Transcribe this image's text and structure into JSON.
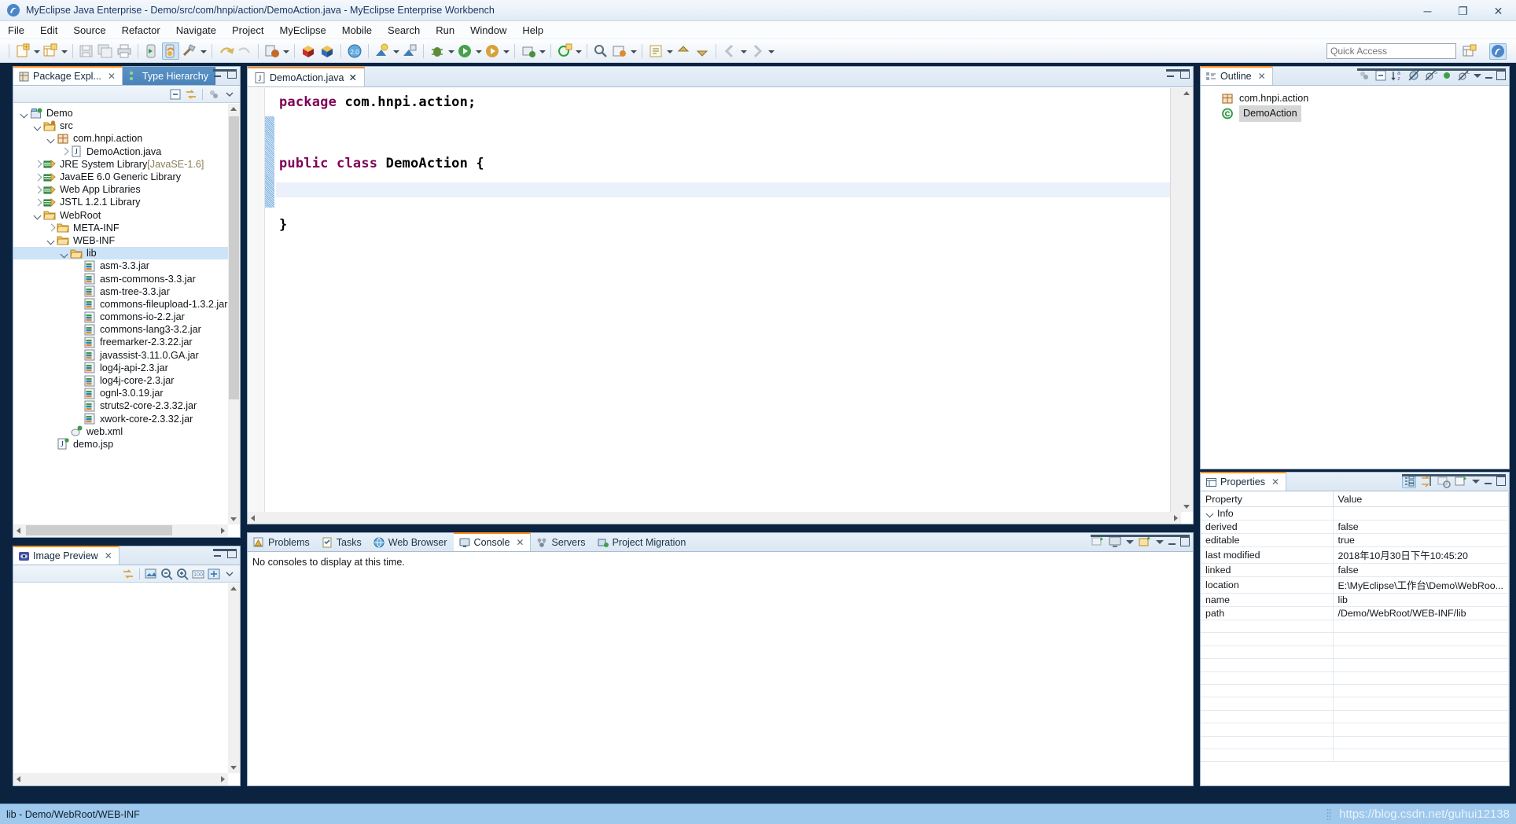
{
  "window": {
    "title": "MyEclipse Java Enterprise - Demo/src/com/hnpi/action/DemoAction.java - MyEclipse Enterprise Workbench",
    "app_icon": "myeclipse-icon",
    "minimize": "─",
    "maximize": "❐",
    "close": "✕"
  },
  "menu": [
    {
      "label": "File"
    },
    {
      "label": "Edit"
    },
    {
      "label": "Source"
    },
    {
      "label": "Refactor"
    },
    {
      "label": "Navigate"
    },
    {
      "label": "Project"
    },
    {
      "label": "MyEclipse"
    },
    {
      "label": "Mobile"
    },
    {
      "label": "Search"
    },
    {
      "label": "Run"
    },
    {
      "label": "Window"
    },
    {
      "label": "Help"
    }
  ],
  "toolbar": {
    "quick_access_placeholder": "Quick Access",
    "quick_access_value": "",
    "buttons": [
      "new-wizard-icon",
      "new-wizard-dropdown",
      "new-jee-icon",
      "new-jee-dropdown",
      "save-icon",
      "save-all-icon",
      "print-icon",
      "run-server-icon",
      "deploy-icon",
      "build-icon",
      "build-dropdown",
      "undo-icon",
      "redo-icon",
      "publish-icon",
      "publish-dropdown",
      "package-icon",
      "package-blue-icon",
      "web20-icon",
      "db-browser-icon",
      "db-browser-dropdown",
      "db-explorer-icon",
      "debug-icon",
      "debug-dropdown",
      "run-icon",
      "run-dropdown",
      "coverage-icon",
      "coverage-dropdown",
      "external-tools-icon",
      "external-tools-dropdown",
      "new-class-icon",
      "new-class-dropdown",
      "search-icon",
      "open-type-icon",
      "open-type-dropdown",
      "annotation-icon",
      "annotation-dropdown",
      "prev-annotation-icon",
      "next-annotation-icon",
      "back-icon",
      "back-dropdown",
      "forward-icon",
      "forward-dropdown"
    ],
    "perspective_buttons": [
      "open-perspective-icon",
      "myeclipse-perspective-icon"
    ]
  },
  "package_explorer": {
    "tabs": [
      {
        "label": "Package Expl...",
        "icon": "package-explorer-icon",
        "active": true,
        "closable": true
      },
      {
        "label": "Type Hierarchy",
        "icon": "type-hierarchy-icon",
        "active": false,
        "closable": false
      }
    ],
    "toolbar_icons": [
      "collapse-all-icon",
      "link-with-editor-icon",
      "view-menu-icon",
      "view-dropdown-icon"
    ],
    "tree": [
      {
        "depth": 0,
        "twisty": "down",
        "icon": "project-icon",
        "label": "Demo",
        "suffix": ""
      },
      {
        "depth": 1,
        "twisty": "down",
        "icon": "source-folder-icon",
        "label": "src",
        "suffix": ""
      },
      {
        "depth": 2,
        "twisty": "down",
        "icon": "package-icon",
        "label": "com.hnpi.action",
        "suffix": ""
      },
      {
        "depth": 3,
        "twisty": "right",
        "icon": "java-file-icon",
        "label": "DemoAction.java",
        "suffix": ""
      },
      {
        "depth": 1,
        "twisty": "right",
        "icon": "library-icon",
        "label": "JRE System Library",
        "suffix": "[JavaSE-1.6]"
      },
      {
        "depth": 1,
        "twisty": "right",
        "icon": "library-icon",
        "label": "JavaEE 6.0 Generic Library",
        "suffix": ""
      },
      {
        "depth": 1,
        "twisty": "right",
        "icon": "library-icon",
        "label": "Web App Libraries",
        "suffix": ""
      },
      {
        "depth": 1,
        "twisty": "right",
        "icon": "library-icon",
        "label": "JSTL 1.2.1 Library",
        "suffix": ""
      },
      {
        "depth": 1,
        "twisty": "down",
        "icon": "folder-icon",
        "label": "WebRoot",
        "suffix": ""
      },
      {
        "depth": 2,
        "twisty": "right",
        "icon": "folder-icon",
        "label": "META-INF",
        "suffix": ""
      },
      {
        "depth": 2,
        "twisty": "down",
        "icon": "folder-icon",
        "label": "WEB-INF",
        "suffix": ""
      },
      {
        "depth": 3,
        "twisty": "down",
        "icon": "folder-icon",
        "label": "lib",
        "suffix": "",
        "selected": true
      },
      {
        "depth": 4,
        "twisty": "none",
        "icon": "jar-icon",
        "label": "asm-3.3.jar",
        "suffix": ""
      },
      {
        "depth": 4,
        "twisty": "none",
        "icon": "jar-icon",
        "label": "asm-commons-3.3.jar",
        "suffix": ""
      },
      {
        "depth": 4,
        "twisty": "none",
        "icon": "jar-icon",
        "label": "asm-tree-3.3.jar",
        "suffix": ""
      },
      {
        "depth": 4,
        "twisty": "none",
        "icon": "jar-icon",
        "label": "commons-fileupload-1.3.2.jar",
        "suffix": ""
      },
      {
        "depth": 4,
        "twisty": "none",
        "icon": "jar-icon",
        "label": "commons-io-2.2.jar",
        "suffix": ""
      },
      {
        "depth": 4,
        "twisty": "none",
        "icon": "jar-icon",
        "label": "commons-lang3-3.2.jar",
        "suffix": ""
      },
      {
        "depth": 4,
        "twisty": "none",
        "icon": "jar-icon",
        "label": "freemarker-2.3.22.jar",
        "suffix": ""
      },
      {
        "depth": 4,
        "twisty": "none",
        "icon": "jar-icon",
        "label": "javassist-3.11.0.GA.jar",
        "suffix": ""
      },
      {
        "depth": 4,
        "twisty": "none",
        "icon": "jar-icon",
        "label": "log4j-api-2.3.jar",
        "suffix": ""
      },
      {
        "depth": 4,
        "twisty": "none",
        "icon": "jar-icon",
        "label": "log4j-core-2.3.jar",
        "suffix": ""
      },
      {
        "depth": 4,
        "twisty": "none",
        "icon": "jar-icon",
        "label": "ognl-3.0.19.jar",
        "suffix": ""
      },
      {
        "depth": 4,
        "twisty": "none",
        "icon": "jar-icon",
        "label": "struts2-core-2.3.32.jar",
        "suffix": ""
      },
      {
        "depth": 4,
        "twisty": "none",
        "icon": "jar-icon",
        "label": "xwork-core-2.3.32.jar",
        "suffix": ""
      },
      {
        "depth": 3,
        "twisty": "none",
        "icon": "xml-file-icon",
        "label": "web.xml",
        "suffix": ""
      },
      {
        "depth": 2,
        "twisty": "none",
        "icon": "jsp-file-icon",
        "label": "demo.jsp",
        "suffix": ""
      }
    ]
  },
  "image_preview": {
    "tab_label": "Image Preview",
    "tab_icon": "image-preview-icon",
    "toolbar_icons": [
      "link-icon",
      "fit-image-icon",
      "zoom-out-icon",
      "zoom-in-icon",
      "zoom-100-icon",
      "fit-window-icon",
      "view-menu-icon"
    ],
    "content": ""
  },
  "editor": {
    "tab_label": "DemoAction.java",
    "tab_icon": "java-file-icon",
    "tab_close": "✕",
    "lines": [
      {
        "segments": [
          {
            "text": "package",
            "style": "kw"
          },
          {
            "text": " com.hnpi.action;",
            "style": "plain"
          }
        ]
      },
      {
        "segments": []
      },
      {
        "segments": [
          {
            "text": "public class",
            "style": "kw"
          },
          {
            "text": " DemoAction {",
            "style": "plain"
          }
        ]
      },
      {
        "segments": []
      },
      {
        "segments": [
          {
            "text": "}",
            "style": "plain"
          }
        ]
      }
    ]
  },
  "outline": {
    "tab_label": "Outline",
    "tab_icon": "outline-icon",
    "tab_close": "✕",
    "toolbar_icons": [
      "collapse-all-icon",
      "sort-icon",
      "hide-fields-icon",
      "hide-static-icon",
      "hide-public-icon",
      "hide-local-icon",
      "view-menu-icon"
    ],
    "items": [
      {
        "icon": "package-icon",
        "label": "com.hnpi.action",
        "selected": false
      },
      {
        "icon": "class-icon",
        "label": "DemoAction",
        "selected": true
      }
    ]
  },
  "properties": {
    "tab_label": "Properties",
    "tab_icon": "properties-icon",
    "tab_close": "✕",
    "toolbar_icons": [
      "show-categories-icon",
      "show-advanced-icon",
      "restore-default-icon",
      "pin-icon",
      "view-menu-icon"
    ],
    "columns": [
      "Property",
      "Value"
    ],
    "group": "Info",
    "rows": [
      {
        "property": "derived",
        "value": "false"
      },
      {
        "property": "editable",
        "value": "true"
      },
      {
        "property": "last modified",
        "value": "2018年10月30日下午10:45:20"
      },
      {
        "property": "linked",
        "value": "false"
      },
      {
        "property": "location",
        "value": "E:\\MyEclipse\\工作台\\Demo\\WebRoo..."
      },
      {
        "property": "name",
        "value": "lib"
      },
      {
        "property": "path",
        "value": "/Demo/WebRoot/WEB-INF/lib"
      }
    ]
  },
  "bottom_panel": {
    "tabs": [
      {
        "label": "Problems",
        "icon": "problems-icon",
        "active": false
      },
      {
        "label": "Tasks",
        "icon": "tasks-icon",
        "active": false
      },
      {
        "label": "Web Browser",
        "icon": "web-browser-icon",
        "active": false
      },
      {
        "label": "Console",
        "icon": "console-icon",
        "active": true,
        "closable": true
      },
      {
        "label": "Servers",
        "icon": "servers-icon",
        "active": false
      },
      {
        "label": "Project Migration",
        "icon": "project-migration-icon",
        "active": false
      }
    ],
    "toolbar_icons": [
      "open-console-icon",
      "display-console-icon",
      "display-console-dropdown",
      "new-console-icon",
      "new-console-dropdown"
    ],
    "console_message": "No consoles to display at this time."
  },
  "statusbar": {
    "text": "lib - Demo/WebRoot/WEB-INF",
    "watermark": "https://blog.csdn.net/guhui12138"
  },
  "colors": {
    "accent_orange": "#ff8c1a",
    "tab_blue": "#4a83ba",
    "selection_blue": "#cde3f7",
    "status_blue": "#9ec8ec",
    "keyword_purple": "#7f0055",
    "desktop_navy": "#0c2340"
  }
}
